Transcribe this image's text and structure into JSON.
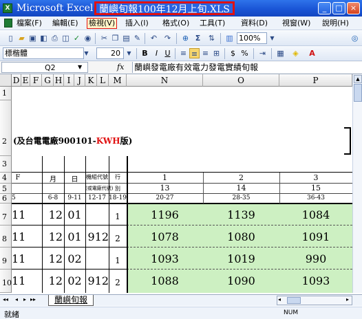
{
  "window": {
    "app_name": "Microsoft Excel",
    "doc_title": "蘭嶼旬報100年12月上旬.XLS",
    "min": "_",
    "max": "□",
    "close": "×"
  },
  "menu": [
    "檔案(F)",
    "編輯(E)",
    "檢視(V)",
    "插入(I)",
    "格式(O)",
    "工具(T)",
    "資料(D)",
    "視窗(W)",
    "說明(H)"
  ],
  "toolbar": {
    "zoom": "100%",
    "font_name": "標楷體",
    "font_size": "20",
    "bold": "B",
    "italic": "I",
    "underline": "U",
    "currency": "$",
    "percent": "%",
    "sum": "Σ"
  },
  "formula_bar": {
    "name_box": "Q2",
    "fx": "fx",
    "content": "蘭嶼發電廠有效電力發電實績旬報"
  },
  "columns": [
    "D",
    "E",
    "F",
    "G",
    "H",
    "I",
    "J",
    "K",
    "L",
    "M",
    "N",
    "O",
    "P"
  ],
  "rows": [
    "1",
    "2",
    "3",
    "4",
    "5",
    "6",
    "7",
    "8",
    "9",
    "10"
  ],
  "sheet": {
    "row2_prefix": "(及台電電廠900101-",
    "row2_red": "KWH",
    "row2_suffix": "版)",
    "header": {
      "c_f": "F",
      "c_month": "月",
      "c_day": "日",
      "c_unit": "機組代號",
      "c_unit2": "(或電廠代號)",
      "c_ci": "行",
      "c_ci2": "別",
      "n4": "1",
      "o4": "2",
      "p4": "3",
      "n5": "13",
      "o5": "14",
      "p5": "15",
      "r6_d": "5",
      "r6_fg": "6-8",
      "r6_hi": "9-11",
      "r6_jl": "12-17",
      "r6_m": "18-19",
      "r6_n": "20-27",
      "r6_o": "28-35",
      "r6_p": "36-43"
    },
    "data": [
      {
        "year": "11",
        "month": "12",
        "day": "01",
        "unit": "",
        "line": "1",
        "n": "1196",
        "o": "1139",
        "p": "1084"
      },
      {
        "year": "11",
        "month": "12",
        "day": "01",
        "unit": "912",
        "line": "2",
        "n": "1078",
        "o": "1080",
        "p": "1091"
      },
      {
        "year": "11",
        "month": "12",
        "day": "02",
        "unit": "",
        "line": "1",
        "n": "1093",
        "o": "1019",
        "p": "990"
      },
      {
        "year": "11",
        "month": "12",
        "day": "02",
        "unit": "912",
        "line": "2",
        "n": "1088",
        "o": "1090",
        "p": "1093"
      }
    ]
  },
  "tabs": {
    "nav_first": "◂◂",
    "nav_prev": "◂",
    "nav_next": "▸",
    "nav_last": "▸▸",
    "sheet_name": "蘭嶼旬報"
  },
  "status": {
    "ready": "就緒",
    "num": "NUM"
  },
  "colors": {
    "title_blue": "#1a55d6",
    "highlight_red": "#e01010",
    "cell_green": "#cdf0c2"
  }
}
